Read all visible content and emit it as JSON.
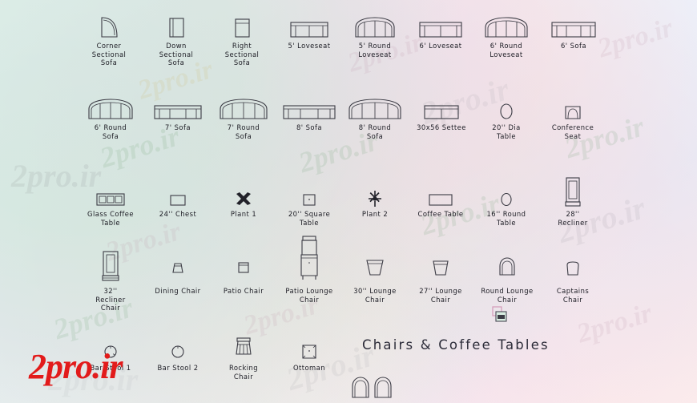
{
  "sheet": {
    "title": "Chairs  &  Coffee  Tables",
    "watermark_main": "2pro.ir",
    "watermark_repeat": "2pro.ir",
    "colors": {
      "line": "#3b3b44",
      "text": "#1c1c24",
      "watermark_red": "#e21b1b",
      "background": "#ffffff"
    }
  },
  "rows": [
    {
      "cells": [
        {
          "label": "Corner\nSectional\nSofa",
          "icon": "corner-sectional-sofa-icon"
        },
        {
          "label": "Down\nSectional\nSofa",
          "icon": "down-sectional-sofa-icon"
        },
        {
          "label": "Right\nSectional\nSofa",
          "icon": "right-sectional-sofa-icon"
        },
        {
          "label": "5'  Loveseat",
          "icon": "5ft-loveseat-icon"
        },
        {
          "label": "5'  Round\nLoveseat",
          "icon": "5ft-round-loveseat-icon"
        },
        {
          "label": "6'  Loveseat",
          "icon": "6ft-loveseat-icon"
        },
        {
          "label": "6'  Round\nLoveseat",
          "icon": "6ft-round-loveseat-icon"
        },
        {
          "label": "6'  Sofa",
          "icon": "6ft-sofa-icon"
        }
      ]
    },
    {
      "cells": [
        {
          "label": "6'  Round\nSofa",
          "icon": "6ft-round-sofa-icon"
        },
        {
          "label": "7'  Sofa",
          "icon": "7ft-sofa-icon"
        },
        {
          "label": "7'  Round\nSofa",
          "icon": "7ft-round-sofa-icon"
        },
        {
          "label": "8'  Sofa",
          "icon": "8ft-sofa-icon"
        },
        {
          "label": "8'  Round\nSofa",
          "icon": "8ft-round-sofa-icon"
        },
        {
          "label": "30x56  Settee",
          "icon": "30x56-settee-icon"
        },
        {
          "label": "20''  Dia\nTable",
          "icon": "20in-dia-table-icon"
        },
        {
          "label": "Conference\nSeat",
          "icon": "conference-seat-icon"
        }
      ]
    },
    {
      "cells": [
        {
          "label": "Glass  Coffee\nTable",
          "icon": "glass-coffee-table-icon"
        },
        {
          "label": "24''  Chest",
          "icon": "24in-chest-icon"
        },
        {
          "label": "Plant  1",
          "icon": "plant-1-icon"
        },
        {
          "label": "20''  Square\nTable",
          "icon": "20in-square-table-icon"
        },
        {
          "label": "Plant  2",
          "icon": "plant-2-icon"
        },
        {
          "label": "Coffee  Table",
          "icon": "coffee-table-icon"
        },
        {
          "label": "16''  Round\nTable",
          "icon": "16in-round-table-icon"
        },
        {
          "label": "28''\nRecliner",
          "icon": "28in-recliner-icon"
        }
      ]
    },
    {
      "cells": [
        {
          "label": "32''\nRecliner\nChair",
          "icon": "32in-recliner-chair-icon"
        },
        {
          "label": "Dining  Chair",
          "icon": "dining-chair-icon"
        },
        {
          "label": "Patio  Chair",
          "icon": "patio-chair-icon"
        },
        {
          "label": "Patio  Lounge\nChair",
          "icon": "patio-lounge-chair-icon"
        },
        {
          "label": "30''  Lounge\nChair",
          "icon": "30in-lounge-chair-icon"
        },
        {
          "label": "27''  Lounge\nChair",
          "icon": "27in-lounge-chair-icon"
        },
        {
          "label": "Round  Lounge\nChair",
          "icon": "round-lounge-chair-icon"
        },
        {
          "label": "Captains\nChair",
          "icon": "captains-chair-icon"
        }
      ]
    },
    {
      "cells": [
        {
          "label": "Bar  Stool  1",
          "icon": "bar-stool-1-icon"
        },
        {
          "label": "Bar  Stool  2",
          "icon": "bar-stool-2-icon"
        },
        {
          "label": "Rocking\nChair",
          "icon": "rocking-chair-icon"
        },
        {
          "label": "Ottoman",
          "icon": "ottoman-icon"
        }
      ]
    }
  ],
  "extras": {
    "stray_icon": "overlapping-block-icon",
    "bottom_pair_icon": "round-lounge-chair-pair-icon"
  }
}
